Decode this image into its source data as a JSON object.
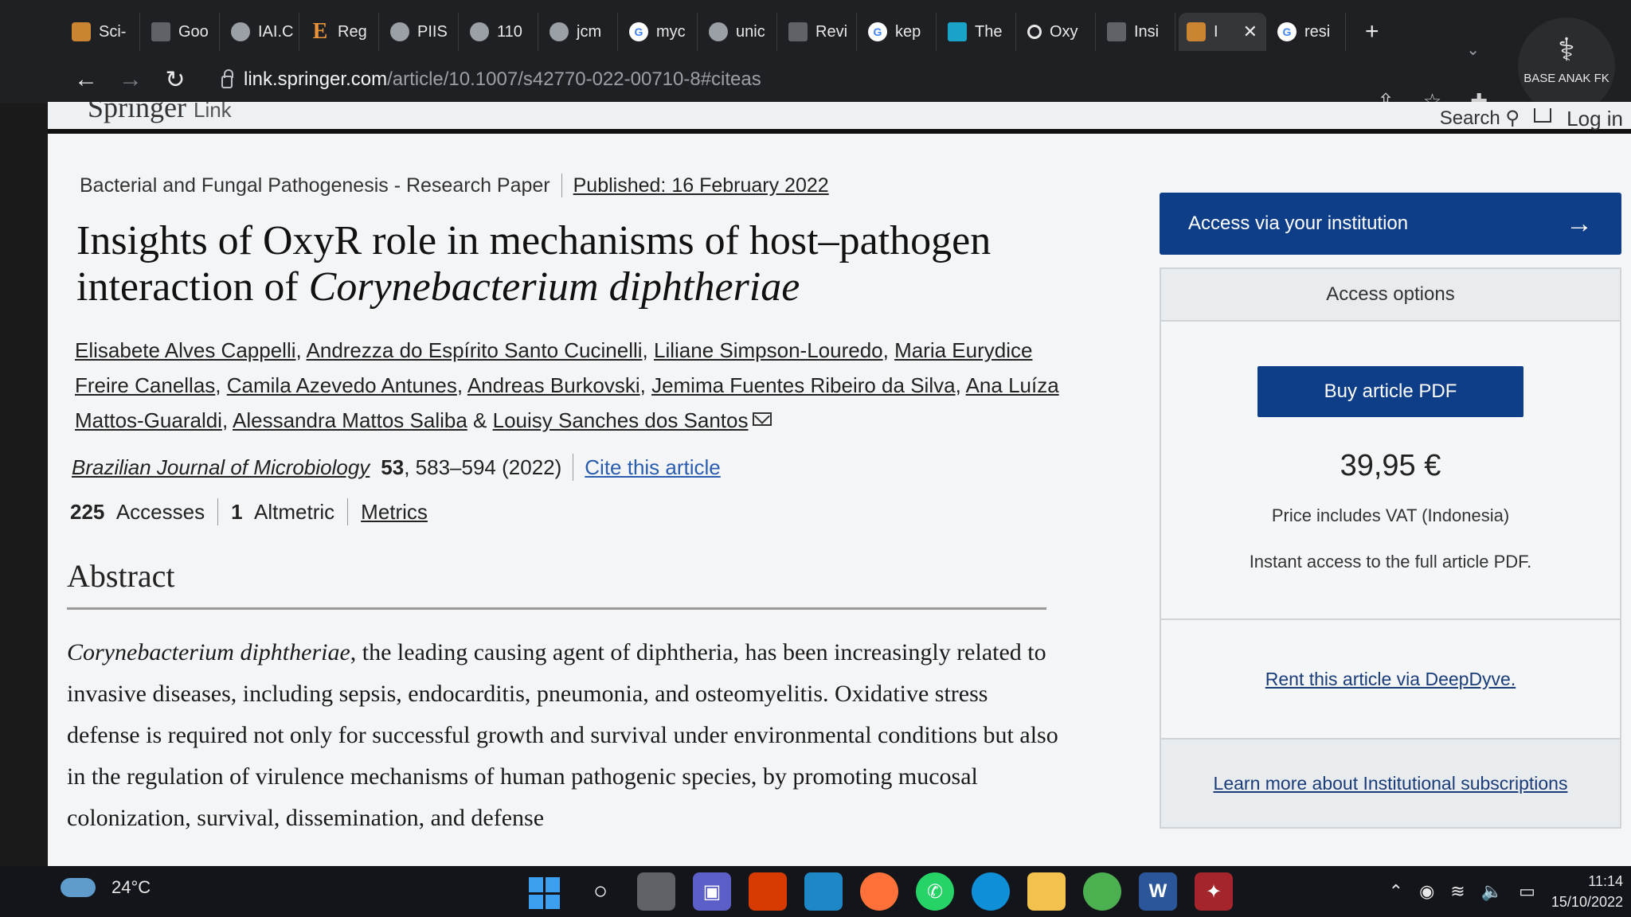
{
  "browser": {
    "tabs": [
      {
        "label": "Sci-",
        "icon": "sci-hub-icon"
      },
      {
        "label": "Goo",
        "icon": "google-translate-icon"
      },
      {
        "label": "IAI.C",
        "icon": "globe-icon"
      },
      {
        "label": "Reg",
        "icon": "elsevier-icon"
      },
      {
        "label": "PIIS",
        "icon": "globe-icon"
      },
      {
        "label": "110",
        "icon": "globe-icon"
      },
      {
        "label": "jcm",
        "icon": "globe-icon"
      },
      {
        "label": "myc",
        "icon": "google-icon"
      },
      {
        "label": "unic",
        "icon": "globe-icon"
      },
      {
        "label": "Revi",
        "icon": "doc-icon"
      },
      {
        "label": "kep",
        "icon": "google-icon"
      },
      {
        "label": "The",
        "icon": "teal-flag-icon"
      },
      {
        "label": "Oxy",
        "icon": "circle-icon"
      },
      {
        "label": "Insi",
        "icon": "doc-icon"
      },
      {
        "label": "I",
        "icon": "springer-icon"
      },
      {
        "label": "resi",
        "icon": "google-icon"
      }
    ],
    "new_tab": "+",
    "url_host": "link.springer.com",
    "url_path": "/article/10.1007/s42770-022-00710-8#citeas",
    "extension_badge": "BASE ANAK FK"
  },
  "header": {
    "brand": "Springer",
    "brand_suffix": "Link",
    "search": "Search",
    "login": "Log in"
  },
  "article": {
    "category": "Bacterial and Fungal Pathogenesis - Research Paper",
    "published": "Published: 16 February 2022",
    "title_part1": "Insights of OxyR role in mechanisms of host–pathogen interaction of ",
    "title_italic": "Corynebacterium diphtheriae",
    "authors": [
      "Elisabete Alves Cappelli",
      "Andrezza do Espírito Santo Cucinelli",
      "Liliane Simpson-Louredo",
      "Maria Eurydice Freire Canellas",
      "Camila Azevedo Antunes",
      "Andreas Burkovski",
      "Jemima Fuentes Ribeiro da Silva",
      "Ana Luíza Mattos-Guaraldi",
      "Alessandra Mattos Saliba",
      "Louisy Sanches dos Santos"
    ],
    "journal": "Brazilian Journal of Microbiology",
    "volume": "53",
    "pages_year": ", 583–594 (2022)",
    "cite": "Cite this article",
    "accesses_count": "225",
    "accesses_label": "Accesses",
    "altmetric_count": "1",
    "altmetric_label": "Altmetric",
    "metrics_link": "Metrics",
    "abstract_heading": "Abstract",
    "abstract_italic": "Corynebacterium diphtheriae",
    "abstract_text": ", the leading causing agent of diphtheria, has been increasingly related to invasive diseases, including sepsis, endocarditis, pneumonia, and osteomyelitis. Oxidative stress defense is required not only for successful growth and survival under environmental conditions but also in the regulation of virulence mechanisms of human pathogenic species, by promoting mucosal colonization, survival, dissemination, and defense"
  },
  "sidebar": {
    "access_institution": "Access via your institution",
    "access_options": "Access options",
    "buy_pdf": "Buy article PDF",
    "price": "39,95 €",
    "vat": "Price includes VAT (Indonesia)",
    "instant": "Instant access to the full article PDF.",
    "rent": "Rent this article via DeepDyve.",
    "learn_more": "Learn more about Institutional subscriptions"
  },
  "taskbar": {
    "temperature": "24°C",
    "time": "11:14",
    "date": "15/10/2022"
  },
  "colors": {
    "springer_blue": "#0f3e88",
    "link_blue": "#2a5db0",
    "chrome_dark": "#1f2023"
  }
}
